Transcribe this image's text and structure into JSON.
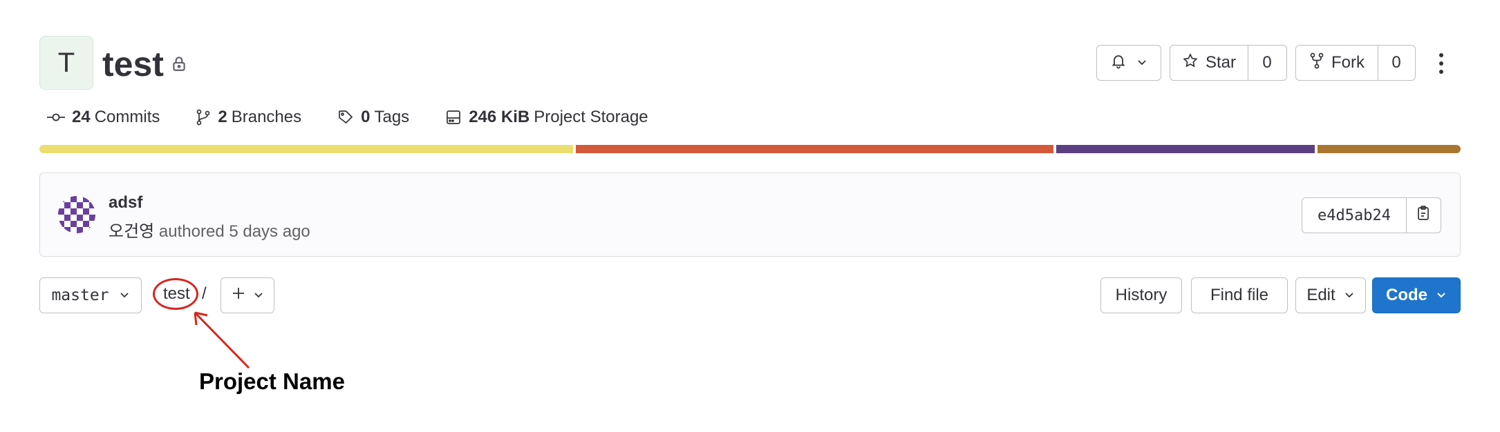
{
  "project": {
    "initial": "T",
    "name": "test"
  },
  "actions": {
    "star_label": "Star",
    "star_count": "0",
    "fork_label": "Fork",
    "fork_count": "0"
  },
  "stats": {
    "commits_count": "24",
    "commits_label": "Commits",
    "branches_count": "2",
    "branches_label": "Branches",
    "tags_count": "0",
    "tags_label": "Tags",
    "storage_size": "246 KiB",
    "storage_label": "Project Storage"
  },
  "language_bar": [
    {
      "color": "#ebdd6e",
      "share": 0.376
    },
    {
      "color": "#d4583a",
      "share": 0.337
    },
    {
      "color": "#5c3f80",
      "share": 0.182
    },
    {
      "color": "#a8762f",
      "share": 0.101
    }
  ],
  "commit": {
    "title": "adsf",
    "author": "오건영",
    "meta": "authored 5 days ago",
    "sha": "e4d5ab24"
  },
  "tree": {
    "branch": "master",
    "path_root": "test",
    "separator": "/",
    "history_label": "History",
    "find_file_label": "Find file",
    "edit_label": "Edit",
    "code_label": "Code"
  },
  "annotation": {
    "label": "Project Name",
    "color": "#d9251c"
  }
}
